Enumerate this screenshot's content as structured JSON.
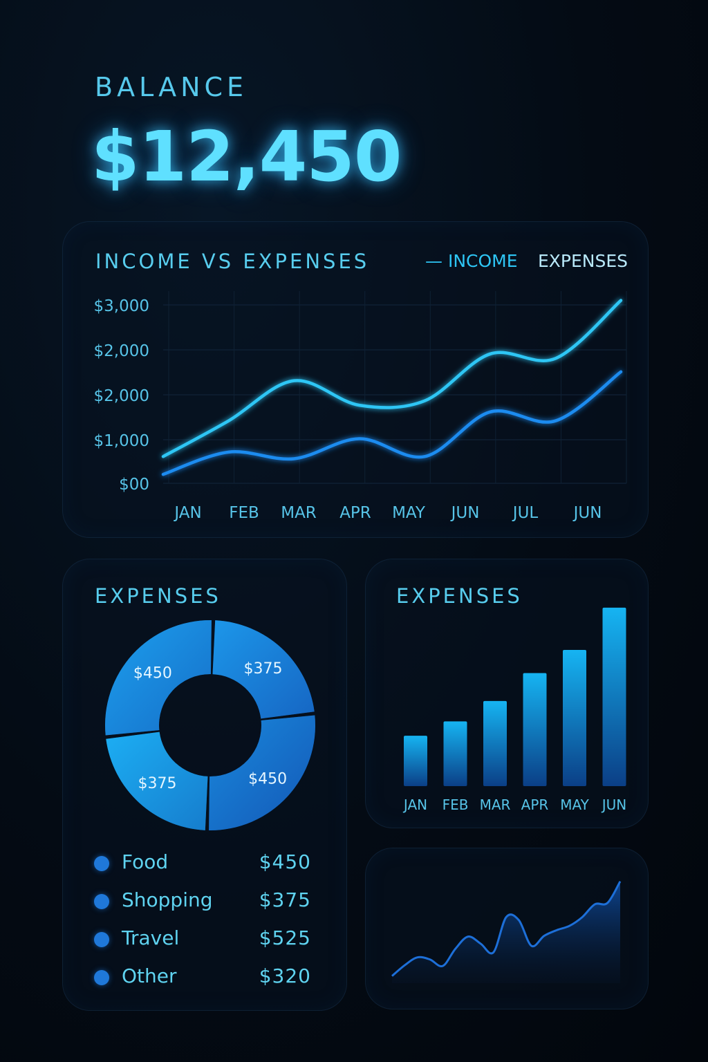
{
  "balance": {
    "label": "BALANCE",
    "value": "$12,450"
  },
  "income_vs_expenses": {
    "title": "INCOME VS EXPENSES",
    "legend": {
      "income": "— INCOME",
      "expenses": "EXPENSES"
    }
  },
  "donut_card": {
    "title": "EXPENSES"
  },
  "bar_card": {
    "title": "EXPENSES"
  },
  "expense_list": [
    {
      "name": "Food",
      "amount": "$450"
    },
    {
      "name": "Shopping",
      "amount": "$375"
    },
    {
      "name": "Travel",
      "amount": "$525"
    },
    {
      "name": "Other",
      "amount": "$320"
    }
  ],
  "colors": {
    "income_line": "#2ec6f5",
    "expenses_line": "#1f8cf0",
    "accent": "#5fe0ff",
    "donut_dark": "#1553a8",
    "donut_light": "#1fb4f5"
  },
  "chart_data": [
    {
      "id": "line",
      "type": "line",
      "title": "INCOME VS EXPENSES",
      "categories": [
        "JAN",
        "FEB",
        "MAR",
        "APR",
        "MAY",
        "JUN",
        "JUL",
        "JUN"
      ],
      "y_ticks": [
        "$3,000",
        "$2,000",
        "$2,000",
        "$1,000",
        "$00"
      ],
      "ylim": [
        0,
        4
      ],
      "grid": true,
      "legend_position": "top-right",
      "series": [
        {
          "name": "INCOME",
          "values": [
            0.6,
            1.4,
            2.3,
            1.75,
            1.85,
            2.9,
            2.8,
            4.1
          ]
        },
        {
          "name": "EXPENSES",
          "values": [
            0.2,
            0.7,
            0.55,
            1.0,
            0.6,
            1.6,
            1.4,
            2.5
          ]
        }
      ]
    },
    {
      "id": "donut",
      "type": "pie",
      "title": "EXPENSES",
      "slices": [
        {
          "label": "$375",
          "value": 375
        },
        {
          "label": "$450",
          "value": 450
        },
        {
          "label": "$375",
          "value": 375
        },
        {
          "label": "$450",
          "value": 450
        }
      ]
    },
    {
      "id": "bar",
      "type": "bar",
      "title": "EXPENSES",
      "categories": [
        "JAN",
        "FEB",
        "MAR",
        "APR",
        "MAY",
        "JUN"
      ],
      "values": [
        74,
        95,
        125,
        166,
        200,
        262
      ],
      "ylim": [
        0,
        270
      ]
    },
    {
      "id": "area",
      "type": "area",
      "values": [
        10,
        25,
        36,
        33,
        24,
        48,
        65,
        55,
        43,
        92,
        88,
        52,
        66,
        74,
        80,
        92,
        110,
        112,
        142
      ]
    }
  ]
}
